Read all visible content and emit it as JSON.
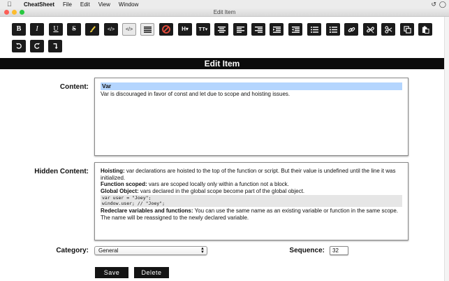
{
  "menubar": {
    "app_name": "CheatSheet",
    "items": [
      "File",
      "Edit",
      "View",
      "Window"
    ]
  },
  "window": {
    "title": "Edit Item"
  },
  "toolbar": {
    "buttons": [
      {
        "name": "bold-button",
        "glyph": "B"
      },
      {
        "name": "italic-button",
        "glyph": "I"
      },
      {
        "name": "underline-button",
        "glyph": "U"
      },
      {
        "name": "strikethrough-button",
        "glyph": "S"
      },
      {
        "name": "highlight-button",
        "glyph": "brush"
      },
      {
        "name": "code-button",
        "glyph": "</>"
      },
      {
        "name": "code-block-button",
        "glyph": "</>"
      },
      {
        "name": "align-justify-button",
        "glyph": "lines"
      },
      {
        "name": "clear-format-button",
        "glyph": "no"
      },
      {
        "name": "heading-button",
        "glyph": "H"
      },
      {
        "name": "text-size-button",
        "glyph": "TT"
      },
      {
        "name": "align-center-button",
        "glyph": "lines"
      },
      {
        "name": "align-left-button",
        "glyph": "lines"
      },
      {
        "name": "align-right-button",
        "glyph": "lines"
      },
      {
        "name": "indent-button",
        "glyph": "lines"
      },
      {
        "name": "outdent-button",
        "glyph": "lines"
      },
      {
        "name": "bullet-list-button",
        "glyph": "lines"
      },
      {
        "name": "numbered-list-button",
        "glyph": "lines"
      },
      {
        "name": "link-button",
        "glyph": "link"
      },
      {
        "name": "unlink-button",
        "glyph": "link"
      },
      {
        "name": "cut-button",
        "glyph": "cut"
      },
      {
        "name": "copy-button",
        "glyph": "copy"
      },
      {
        "name": "paste-button",
        "glyph": "paste"
      },
      {
        "name": "undo-button",
        "glyph": "undo"
      },
      {
        "name": "redo-button",
        "glyph": "redo"
      },
      {
        "name": "return-button",
        "glyph": "return"
      }
    ]
  },
  "page": {
    "heading": "Edit Item"
  },
  "form": {
    "content_label": "Content:",
    "content": {
      "selected_line": "Var",
      "body": "Var is discouraged in favor of const and let due to scope and hoisting issues."
    },
    "hidden_label": "Hidden Content:",
    "hidden": {
      "p1_bold": "Hoisting:",
      "p1_text": " var declarations are hoisted to the top of the function or script. But their value is undefined until the line it was initialized.",
      "p2_bold": "Function scoped:",
      "p2_text": " vars are scoped locally only within a function not a block.",
      "p3_bold": "Global Object:",
      "p3_text": " vars declared in the global scope become part of the global object.",
      "code_line1": "var user = \"Joey\";",
      "code_line2": "window.user; // \"Joey\";",
      "p4_bold": "Redeclare variables and functions:",
      "p4_text": " You can use the same name as an existing variable or function in the same scope. The name will be reassigned to the newly declared variable."
    },
    "category_label": "Category:",
    "category_value": "General",
    "sequence_label": "Sequence:",
    "sequence_value": "32",
    "save_label": "Save",
    "delete_label": "Delete"
  },
  "colors": {
    "toolbar_button": "#1b1b1b",
    "header_bar": "#0c0c0c",
    "selection": "#b4d5fe",
    "close_light": "#fc5f57",
    "minimize_light": "#fdbc2e",
    "zoom_light": "#28c840"
  }
}
